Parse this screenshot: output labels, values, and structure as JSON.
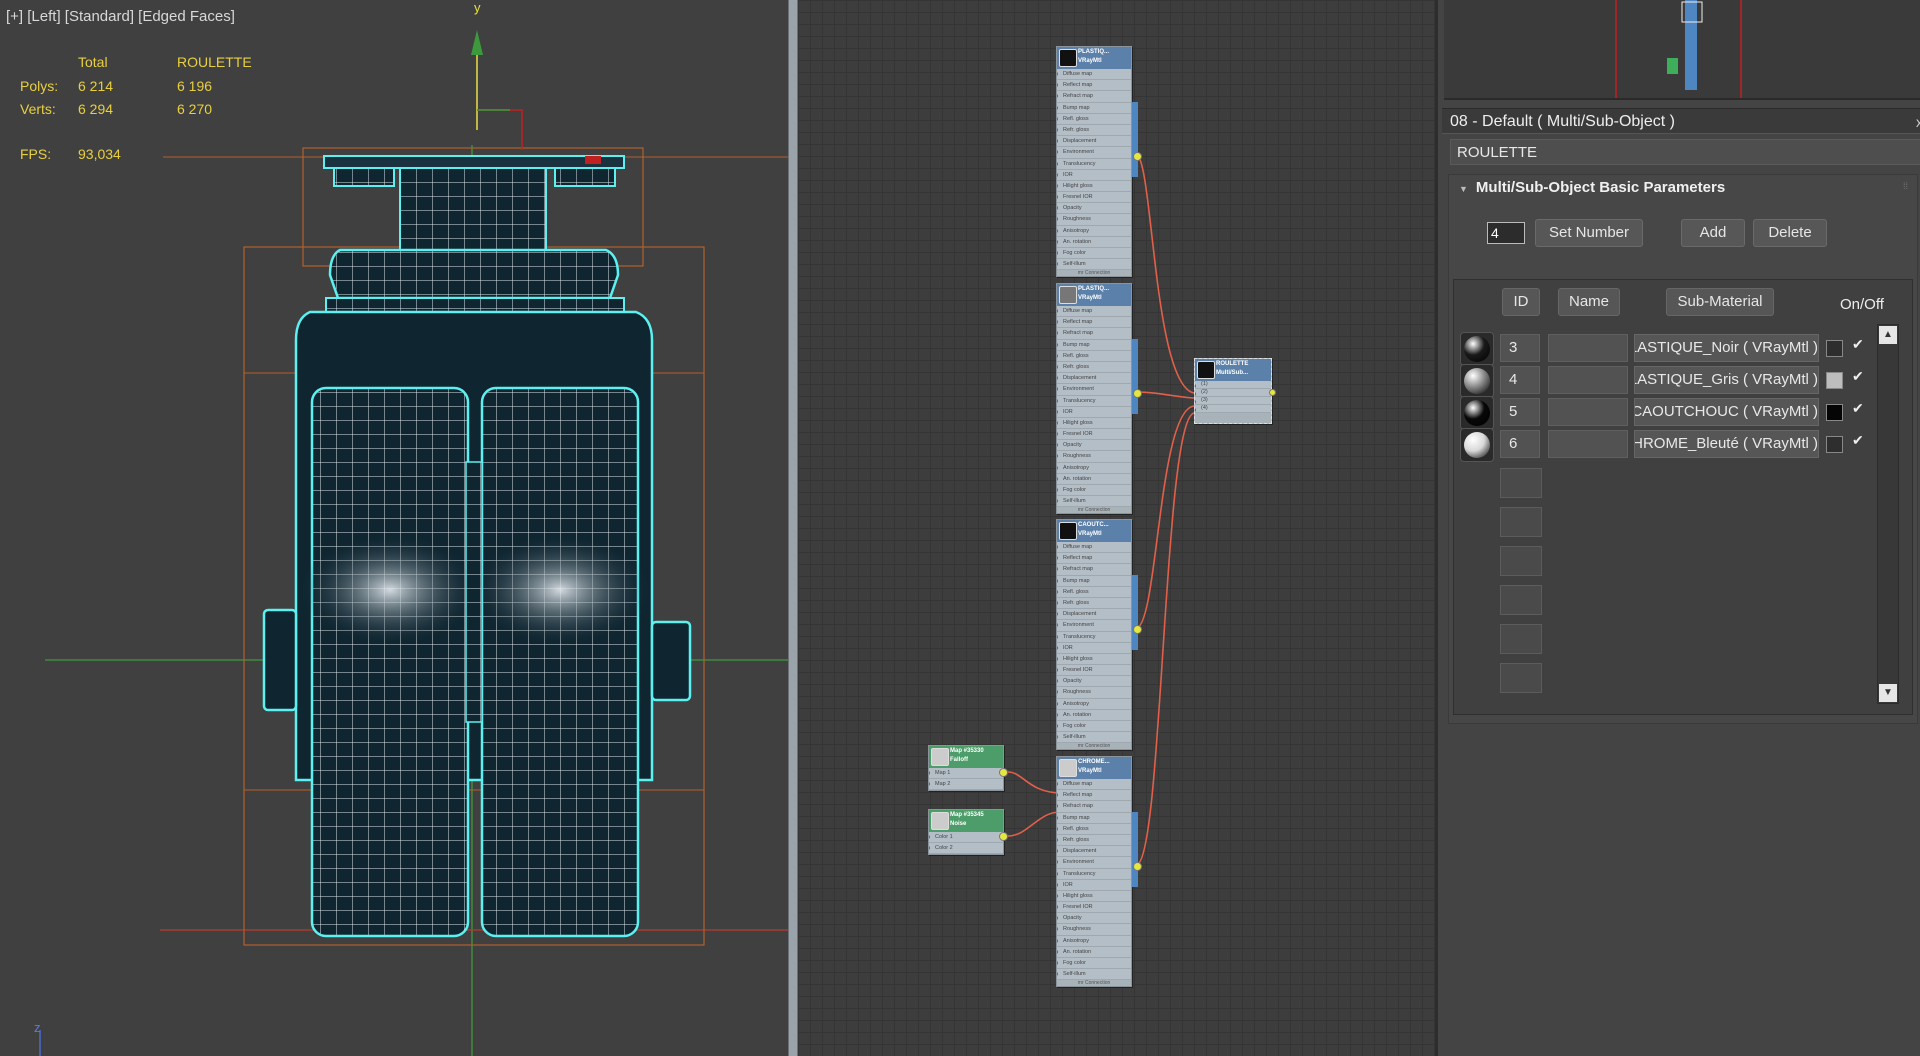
{
  "viewport": {
    "label": "[+] [Left] [Standard] [Edged Faces]",
    "stats": {
      "col_total": "Total",
      "col_selected": "ROULETTE",
      "polys_label": "Polys:",
      "polys_total": "6 214",
      "polys_selected": "6 196",
      "verts_label": "Verts:",
      "verts_total": "6 294",
      "verts_selected": "6 270",
      "fps_label": "FPS:",
      "fps_value": "93,034"
    },
    "axis_y": "y",
    "axis_z": "z"
  },
  "nodes": {
    "n1": {
      "title1": "PLASTIQ...",
      "title2": "VRayMtl"
    },
    "n2": {
      "title1": "PLASTIQ...",
      "title2": "VRayMtl"
    },
    "n3": {
      "title1": "CAOUTC...",
      "title2": "VRayMtl"
    },
    "n4": {
      "title1": "CHROME...",
      "title2": "VRayMtl"
    },
    "multi": {
      "title1": "ROULETTE",
      "title2": "Multi/Sub..."
    },
    "map1": {
      "title1": "Map #35330",
      "title2": "Falloff",
      "slots": [
        "Map 1",
        "Map 2"
      ]
    },
    "map2": {
      "title1": "Map #35345",
      "title2": "Noise",
      "slots": [
        "Color 1",
        "Color 2"
      ]
    },
    "vray_slots": [
      "Diffuse map",
      "Reflect map",
      "Refract map",
      "Bump map",
      "Refl. gloss",
      "Refr. gloss",
      "Displacement",
      "Environment",
      "Translucency",
      "IOR",
      "Hilight gloss",
      "Fresnel IOR",
      "Opacity",
      "Roughness",
      "Anisotropy",
      "An. rotation",
      "Fog color",
      "Self-illum"
    ],
    "vray_footer": "mr Connection",
    "multi_slots": [
      "(1)",
      "(2)",
      "(3)",
      "(4)"
    ]
  },
  "panel": {
    "title": "08 - Default  ( Multi/Sub-Object )",
    "close": "x",
    "material_name": "ROULETTE",
    "rollout_title": "Multi/Sub-Object Basic Parameters",
    "rollout_arrow": "▼",
    "count_value": "4",
    "set_number": "Set Number",
    "add": "Add",
    "delete": "Delete",
    "hdr_id": "ID",
    "hdr_name": "Name",
    "hdr_submaterial": "Sub-Material",
    "hdr_onoff": "On/Off",
    "rows": [
      {
        "id": "3",
        "sub": "PLASTIQUE_Noir  ( VRayMtl )",
        "swatch": "#2e2e2e",
        "ball": "#1a1a1a",
        "check": "✔"
      },
      {
        "id": "4",
        "sub": "PLASTIQUE_Gris  ( VRayMtl )",
        "swatch": "#bdbdbd",
        "ball": "#8a8a8a",
        "check": "✔"
      },
      {
        "id": "5",
        "sub": "CAOUTCHOUC  ( VRayMtl )",
        "swatch": "#050505",
        "ball": "#080808",
        "check": "✔"
      },
      {
        "id": "6",
        "sub": "CHROME_Bleuté  ( VRayMtl )",
        "swatch": "#2e2e2e",
        "ball": "#d8d8d8",
        "check": "✔"
      }
    ],
    "scroll_up": "▲",
    "scroll_down": "▼"
  }
}
